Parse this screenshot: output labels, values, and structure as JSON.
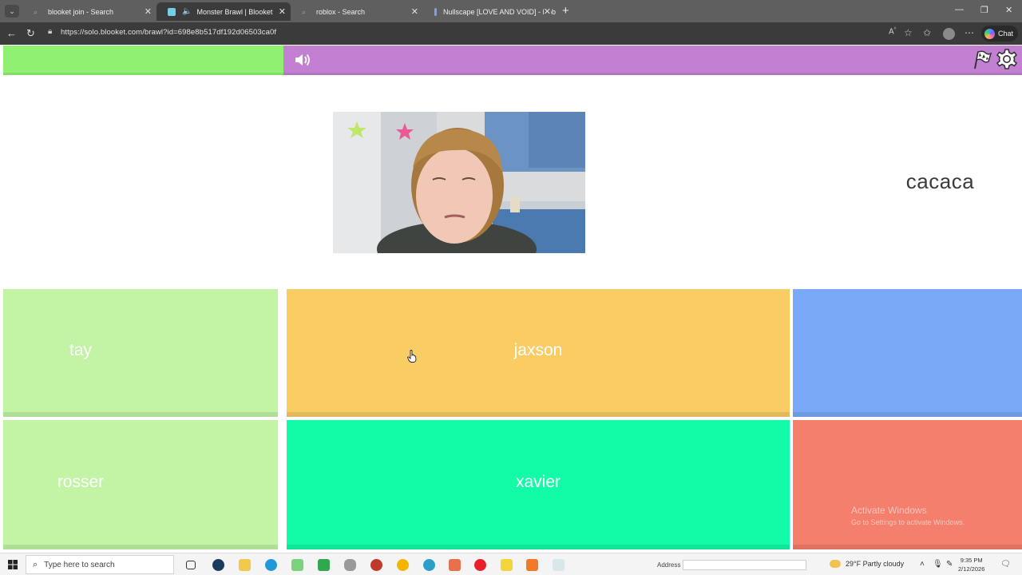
{
  "browser": {
    "tabs": [
      {
        "title": "blooket join - Search",
        "active": false,
        "favicon": "search-icon"
      },
      {
        "title": "Monster Brawl | Blooket",
        "active": true,
        "favicon": "blooket-icon",
        "audio": true
      },
      {
        "title": "roblox - Search",
        "active": false,
        "favicon": "search-icon"
      },
      {
        "title": "Nullscape [LOVE AND VOID] - Rob",
        "active": false,
        "favicon": "roblox-icon"
      }
    ],
    "url": "https://solo.blooket.com/brawl?id=698e8b517df192d06503ca0f",
    "chat_label": "Chat"
  },
  "game": {
    "progress": 0.275,
    "question": "cacaca",
    "colors": {
      "progress": "#8ff071",
      "header": "#c37fd1"
    },
    "answers": [
      {
        "label": "tay",
        "color": "#c3f4a6"
      },
      {
        "label": "jaxson",
        "color": "#f9cd64"
      },
      {
        "label": "",
        "color": "#7aa9f7"
      },
      {
        "label": "rosser",
        "color": "#c3f4a6"
      },
      {
        "label": "xavier",
        "color": "#12fca8"
      },
      {
        "label": "",
        "color": "#f47f6c"
      }
    ]
  },
  "watermark": {
    "line1": "Activate Windows",
    "line2": "Go to Settings to activate Windows."
  },
  "taskbar": {
    "search_placeholder": "Type here to search",
    "address_label": "Address",
    "weather": "29°F  Partly cloudy",
    "time": "9:35 PM",
    "date": "2/12/2026"
  }
}
